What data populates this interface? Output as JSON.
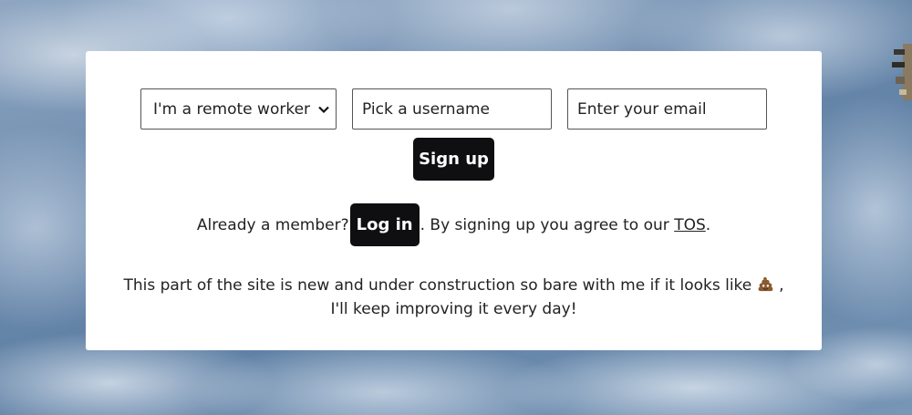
{
  "form": {
    "role_select": {
      "selected": "I'm a remote worker"
    },
    "username_placeholder": "Pick a username",
    "email_placeholder": "Enter your email",
    "signup_label": "Sign up"
  },
  "member_line": {
    "prefix": "Already a member?",
    "login_label": "Log in",
    "middle": ". By signing up you agree to our",
    "tos_label": "TOS",
    "suffix": "."
  },
  "note": {
    "before_emoji": "This part of the site is new and under construction so bare with me if it looks like",
    "emoji_icon": "poop-icon",
    "after_emoji": ", I'll keep improving it every day!"
  }
}
